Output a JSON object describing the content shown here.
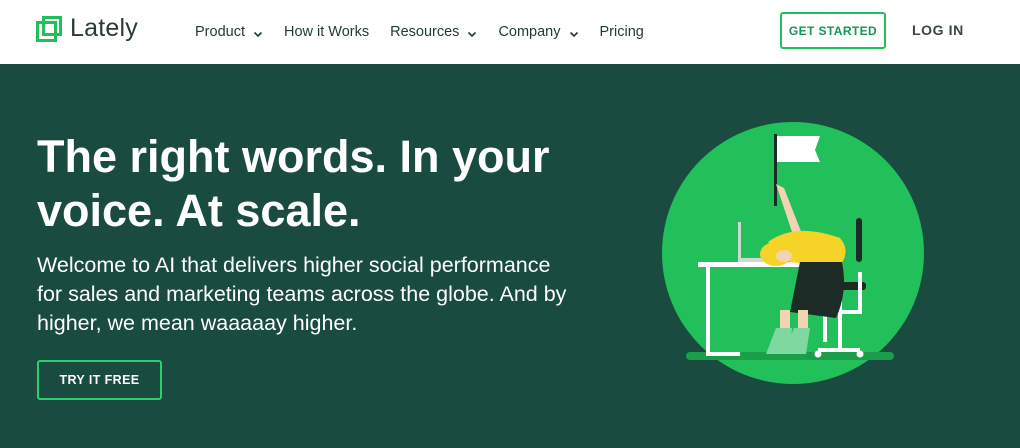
{
  "brand": {
    "name": "Lately",
    "logo_icon": "nested-squares-logo",
    "color": "#1fbf5b"
  },
  "nav": {
    "items": [
      {
        "label": "Product",
        "has_dropdown": true
      },
      {
        "label": "How it Works",
        "has_dropdown": false
      },
      {
        "label": "Resources",
        "has_dropdown": true
      },
      {
        "label": "Company",
        "has_dropdown": true
      },
      {
        "label": "Pricing",
        "has_dropdown": false
      }
    ],
    "cta_label": "GET STARTED",
    "login_label": "LOG IN"
  },
  "hero": {
    "headline": "The right words. In your voice. At scale.",
    "subtext": "Welcome to AI that delivers higher social performance for sales and marketing teams across the globe. And by higher, we mean waaaaay higher.",
    "button_label": "TRY IT FREE",
    "background_color": "#194b41",
    "illustration": "person-at-desk-waving-white-flag"
  }
}
